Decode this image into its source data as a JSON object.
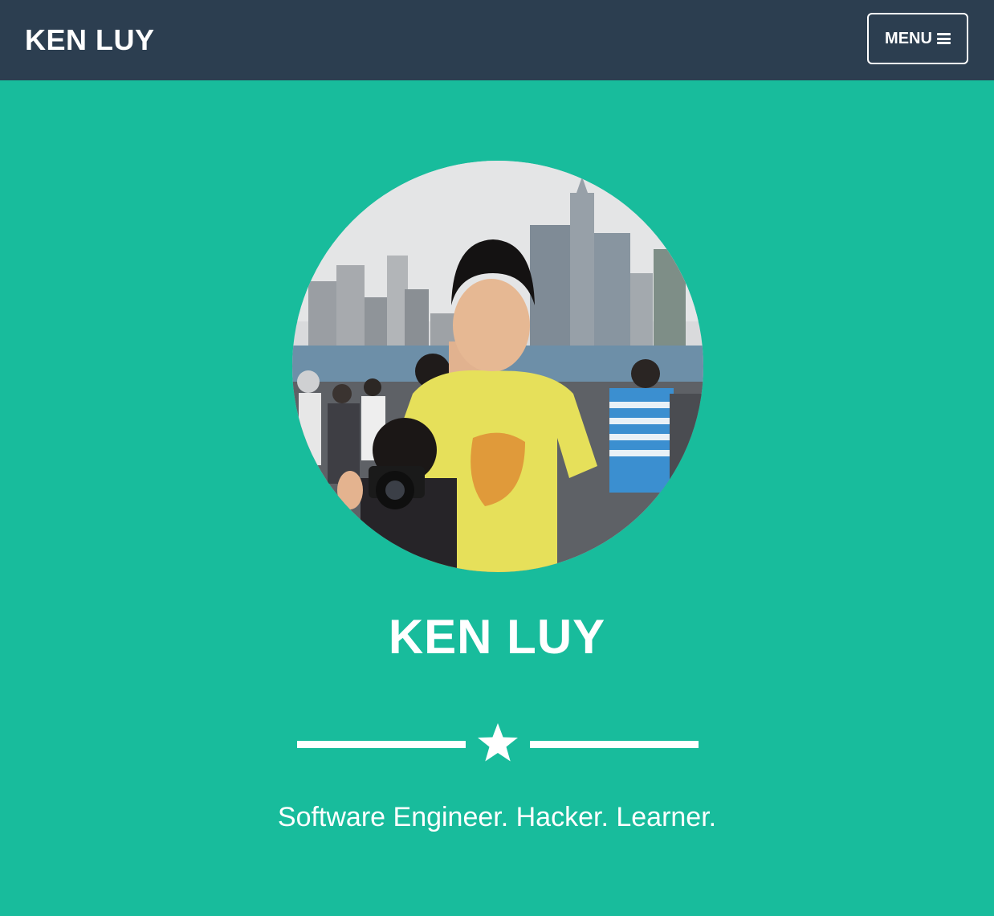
{
  "navbar": {
    "brand": "KEN LUY",
    "menu_label": "MENU",
    "menu_icon": "hamburger-icon"
  },
  "hero": {
    "avatar_icon": "profile-photo",
    "name": "KEN LUY",
    "divider_icon": "star-icon",
    "tagline": "Software Engineer. Hacker. Learner."
  },
  "colors": {
    "navbar_bg": "#2c3e50",
    "hero_bg": "#18bc9c",
    "text": "#ffffff"
  }
}
